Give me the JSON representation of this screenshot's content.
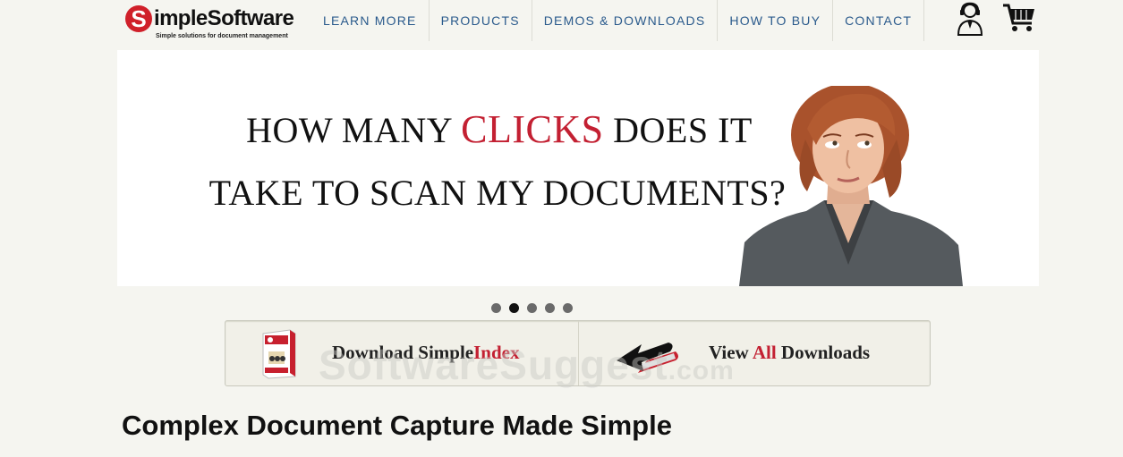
{
  "header": {
    "logo": {
      "mark": "S",
      "name": "impleSoftware",
      "tagline": "Simple solutions for document management"
    },
    "nav": [
      "LEARN MORE",
      "PRODUCTS",
      "DEMOS & DOWNLOADS",
      "HOW TO BUY",
      "CONTACT"
    ],
    "icons": {
      "support": "support-agent-icon",
      "cart": "shopping-cart-icon"
    }
  },
  "banner": {
    "line1_pre": "HOW MANY ",
    "line1_highlight": "CLICKS",
    "line1_post": " DOES IT",
    "line2": "TAKE TO SCAN MY DOCUMENTS?"
  },
  "carousel": {
    "slides": 5,
    "active_index": 1
  },
  "downloads": {
    "left": {
      "text_pre": "Download Simple",
      "text_red": "Index"
    },
    "right": {
      "text_pre": "View ",
      "text_red": "All",
      "text_post": " Downloads"
    }
  },
  "watermark": {
    "text": "SoftwareSuggest",
    "suffix": ".com"
  },
  "main": {
    "heading": "Complex Document Capture Made Simple"
  },
  "colors": {
    "brand_red": "#c32032",
    "nav_blue": "#2a5a8c",
    "background": "#f5f5f0"
  }
}
